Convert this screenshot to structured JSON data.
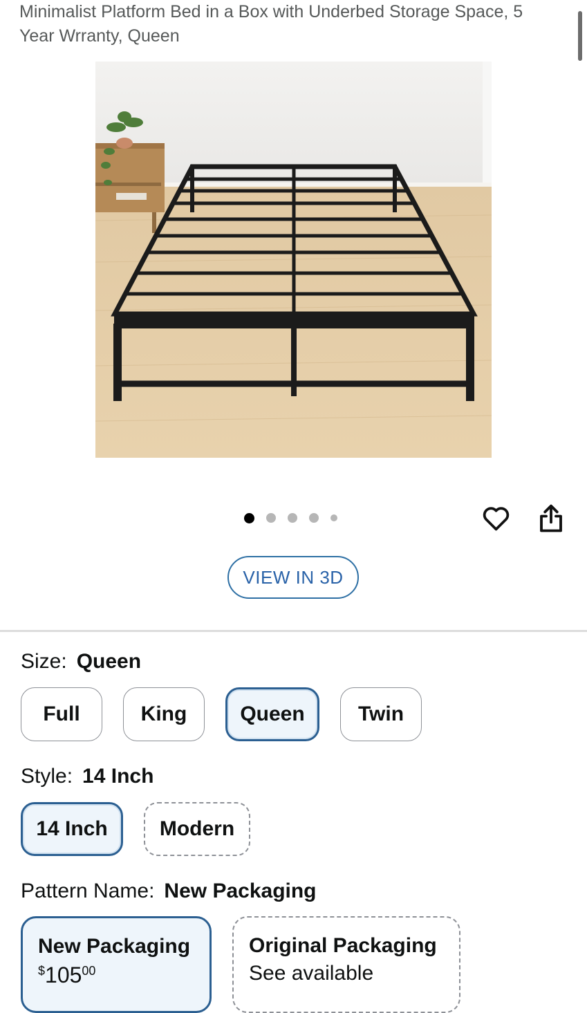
{
  "product": {
    "title": "Minimalist Platform Bed in a Box with Underbed Storage Space, 5 Year Wrranty, Queen"
  },
  "gallery": {
    "image_count": 5,
    "active_index": 0,
    "view_3d_label": "VIEW IN 3D"
  },
  "actions": {
    "wishlist_icon": "heart-icon",
    "share_icon": "share-icon"
  },
  "size": {
    "label": "Size:",
    "selected": "Queen",
    "options": [
      "Full",
      "King",
      "Queen",
      "Twin"
    ]
  },
  "style": {
    "label": "Style:",
    "selected": "14 Inch",
    "options": [
      "14 Inch",
      "Modern"
    ]
  },
  "pattern": {
    "label": "Pattern Name:",
    "selected": "New Packaging",
    "options": [
      {
        "name": "New Packaging",
        "price_symbol": "$",
        "price_whole": "105",
        "price_fraction": "00"
      },
      {
        "name": "Original Packaging",
        "availability": "See available"
      }
    ]
  },
  "colors": {
    "accent": "#2b5f91",
    "link": "#2962a8",
    "selected_bg": "#eef5fb"
  }
}
